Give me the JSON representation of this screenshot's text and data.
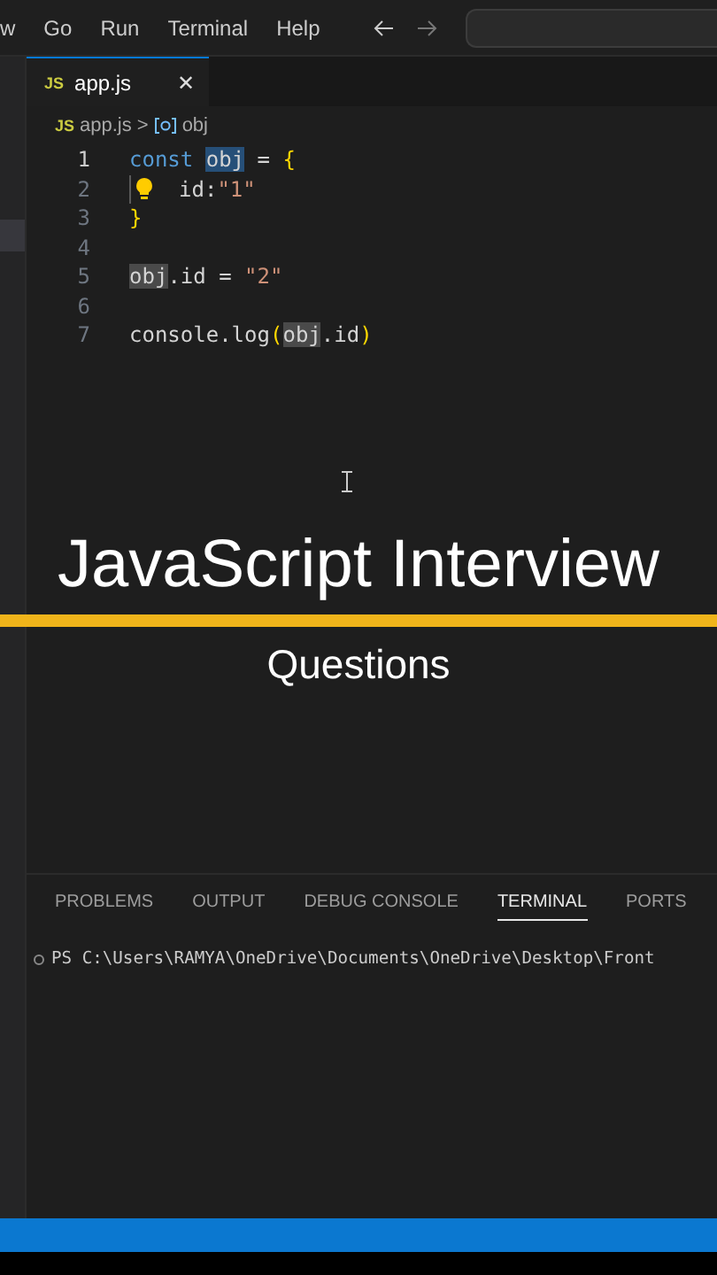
{
  "menu": [
    "w",
    "Go",
    "Run",
    "Terminal",
    "Help"
  ],
  "tab": {
    "icon_text": "JS",
    "name": "app.js",
    "close": "✕"
  },
  "breadcrumb": {
    "icon_text": "JS",
    "file": "app.js",
    "separator": ">",
    "symbol": "obj"
  },
  "code": [
    {
      "number": "1",
      "current": true,
      "tokens": [
        {
          "text": "const ",
          "kind": "keyword"
        },
        {
          "text": "obj",
          "kind": "selected"
        },
        {
          "text": " = ",
          "kind": "plain"
        },
        {
          "text": "{",
          "kind": "brace"
        }
      ]
    },
    {
      "number": "2",
      "current": false,
      "lightbulb": true,
      "tokens": [
        {
          "text": "id:",
          "kind": "plain"
        },
        {
          "text": "\"1\"",
          "kind": "string"
        }
      ]
    },
    {
      "number": "3",
      "current": false,
      "tokens": [
        {
          "text": "}",
          "kind": "brace"
        }
      ]
    },
    {
      "number": "4",
      "current": false
    },
    {
      "number": "5",
      "current": false,
      "tokens": [
        {
          "text": "obj",
          "kind": "match"
        },
        {
          "text": ".id = ",
          "kind": "plain"
        },
        {
          "text": "\"2\"",
          "kind": "string"
        }
      ]
    },
    {
      "number": "6",
      "current": false
    },
    {
      "number": "7",
      "current": false,
      "tokens": [
        {
          "text": "console.log",
          "kind": "plain"
        },
        {
          "text": "(",
          "kind": "brace"
        },
        {
          "text": "obj",
          "kind": "match"
        },
        {
          "text": ".id",
          "kind": "plain"
        },
        {
          "text": ")",
          "kind": "brace"
        }
      ]
    }
  ],
  "overlay": {
    "title": "JavaScript Interview",
    "subtitle": "Questions"
  },
  "panel_tabs": [
    {
      "label": "PROBLEMS",
      "selected": false
    },
    {
      "label": "OUTPUT",
      "selected": false
    },
    {
      "label": "DEBUG CONSOLE",
      "selected": false
    },
    {
      "label": "TERMINAL",
      "selected": true
    },
    {
      "label": "PORTS",
      "selected": false
    }
  ],
  "terminal": [
    "PS C:\\Users\\RAMYA\\OneDrive\\Documents\\OneDrive\\Desktop\\Front"
  ]
}
